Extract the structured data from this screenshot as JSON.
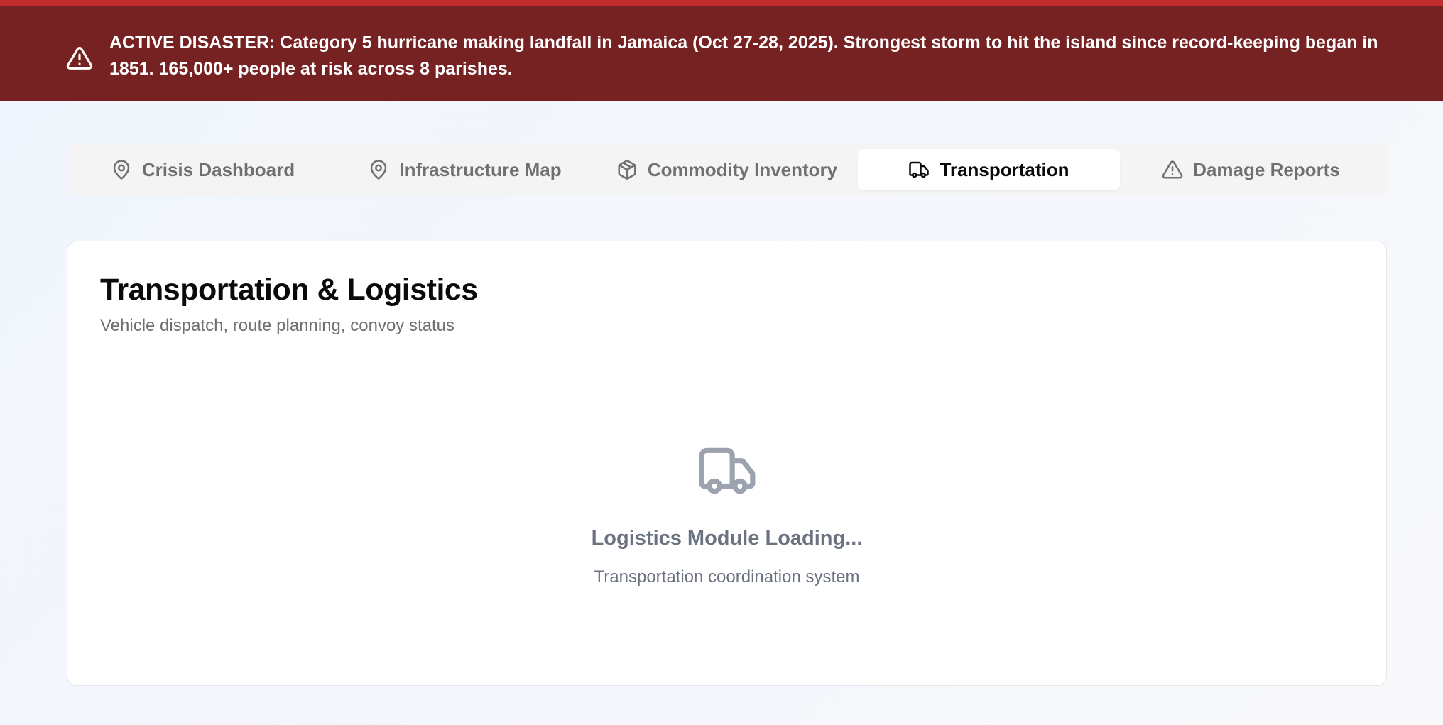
{
  "alert": {
    "label": "ACTIVE DISASTER:",
    "message": " Category 5 hurricane making landfall in Jamaica (Oct 27-28, 2025). Strongest storm to hit the island since record-keeping began in 1851. 165,000+ people at risk across 8 parishes.",
    "icon": "alert-triangle-icon",
    "colors": {
      "background": "#772222",
      "top_stripe": "#c22b2b",
      "text": "#ffffff"
    }
  },
  "tabs": [
    {
      "label": "Crisis Dashboard",
      "icon": "map-pin-icon",
      "active": false
    },
    {
      "label": "Infrastructure Map",
      "icon": "map-pin-icon",
      "active": false
    },
    {
      "label": "Commodity Inventory",
      "icon": "package-icon",
      "active": false
    },
    {
      "label": "Transportation",
      "icon": "truck-icon",
      "active": true
    },
    {
      "label": "Damage Reports",
      "icon": "alert-triangle-icon",
      "active": false
    }
  ],
  "main": {
    "title": "Transportation & Logistics",
    "subtitle": "Vehicle dispatch, route planning, convoy status",
    "empty_state": {
      "icon": "truck-icon",
      "title": "Logistics Module Loading...",
      "description": "Transportation coordination system"
    }
  }
}
